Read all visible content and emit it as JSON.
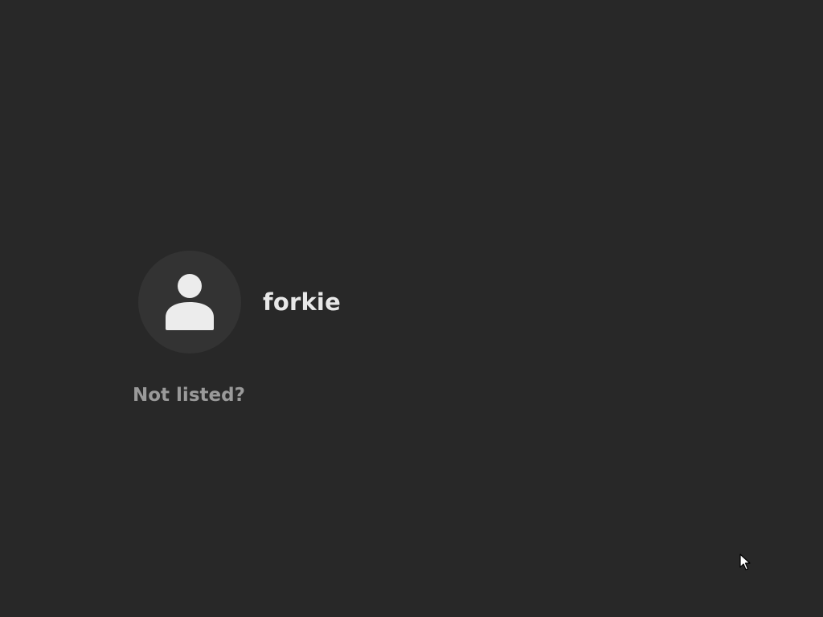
{
  "user_list": {
    "users": [
      {
        "username": "forkie",
        "avatar_icon": "person-icon"
      }
    ]
  },
  "not_listed": {
    "label": "Not listed?"
  },
  "colors": {
    "background": "#282828",
    "avatar_bg": "#333333",
    "username_text": "#e8e8e8",
    "not_listed_text": "#9a9a9a"
  },
  "pointer": {
    "icon": "mouse-pointer-icon"
  }
}
